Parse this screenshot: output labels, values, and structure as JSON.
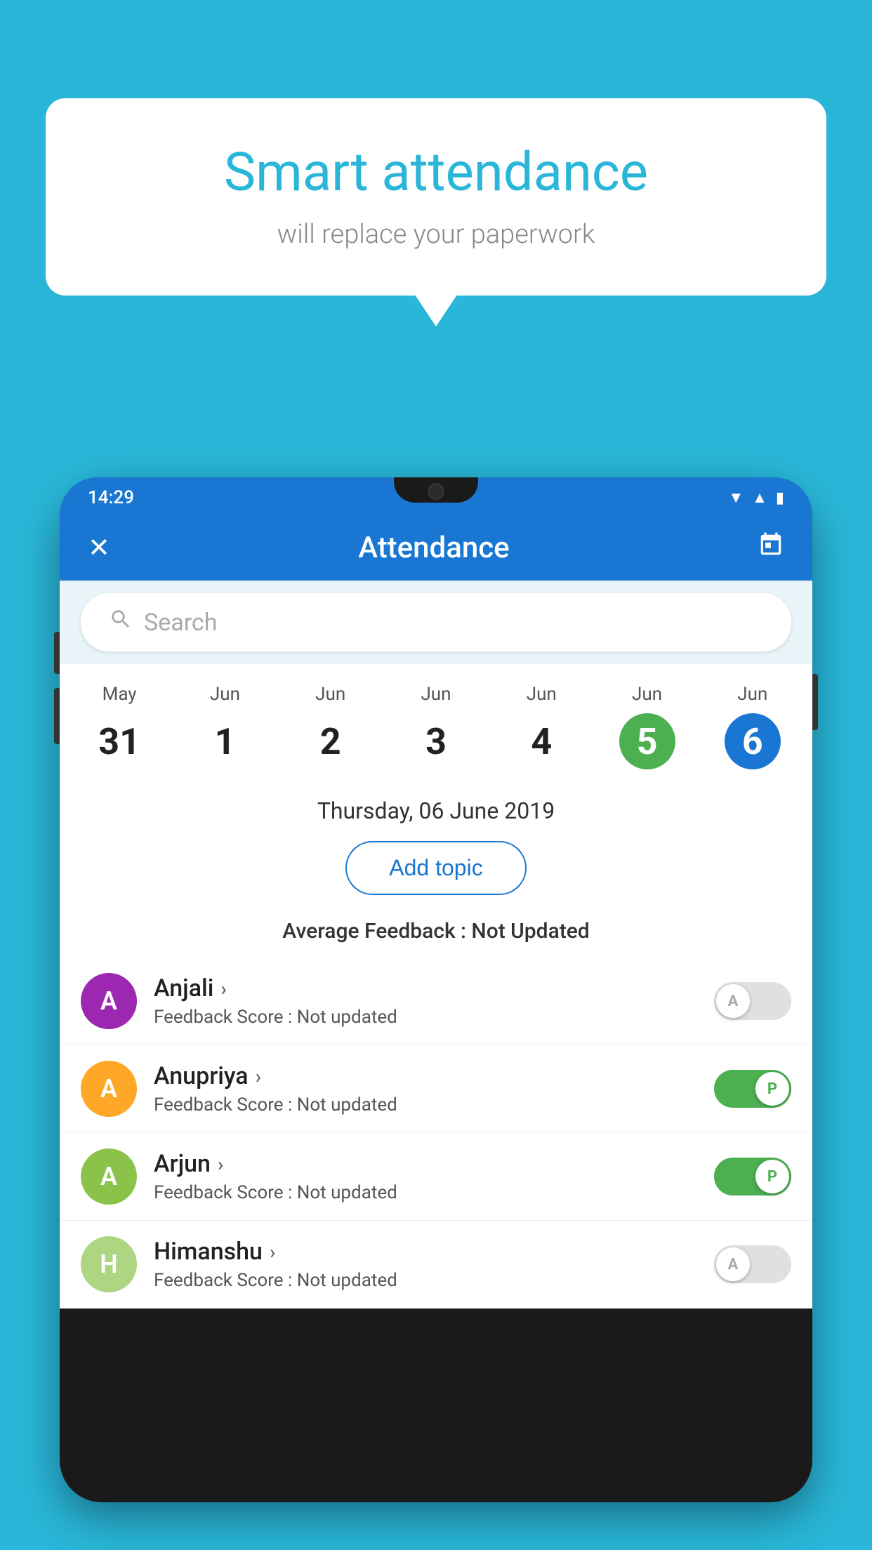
{
  "background_color": "#29b6d8",
  "speech_bubble": {
    "title": "Smart attendance",
    "subtitle": "will replace your paperwork"
  },
  "status_bar": {
    "time": "14:29",
    "icons": [
      "wifi",
      "signal",
      "battery"
    ]
  },
  "app_bar": {
    "title": "Attendance",
    "close_label": "✕",
    "calendar_label": "📅"
  },
  "search": {
    "placeholder": "Search"
  },
  "calendar": {
    "days": [
      {
        "month": "May",
        "date": "31",
        "state": "normal"
      },
      {
        "month": "Jun",
        "date": "1",
        "state": "normal"
      },
      {
        "month": "Jun",
        "date": "2",
        "state": "normal"
      },
      {
        "month": "Jun",
        "date": "3",
        "state": "normal"
      },
      {
        "month": "Jun",
        "date": "4",
        "state": "normal"
      },
      {
        "month": "Jun",
        "date": "5",
        "state": "today"
      },
      {
        "month": "Jun",
        "date": "6",
        "state": "selected"
      }
    ]
  },
  "selected_date": "Thursday, 06 June 2019",
  "add_topic_label": "Add topic",
  "avg_feedback_label": "Average Feedback :",
  "avg_feedback_value": "Not Updated",
  "students": [
    {
      "name": "Anjali",
      "avatar_letter": "A",
      "avatar_color": "#9c27b0",
      "feedback_label": "Feedback Score :",
      "feedback_value": "Not updated",
      "toggle_state": "off",
      "toggle_letter": "A"
    },
    {
      "name": "Anupriya",
      "avatar_letter": "A",
      "avatar_color": "#ffa726",
      "feedback_label": "Feedback Score :",
      "feedback_value": "Not updated",
      "toggle_state": "on",
      "toggle_letter": "P"
    },
    {
      "name": "Arjun",
      "avatar_letter": "A",
      "avatar_color": "#8bc34a",
      "feedback_label": "Feedback Score :",
      "feedback_value": "Not updated",
      "toggle_state": "on",
      "toggle_letter": "P"
    },
    {
      "name": "Himanshu",
      "avatar_letter": "H",
      "avatar_color": "#aed581",
      "feedback_label": "Feedback Score :",
      "feedback_value": "Not updated",
      "toggle_state": "off",
      "toggle_letter": "A"
    }
  ]
}
